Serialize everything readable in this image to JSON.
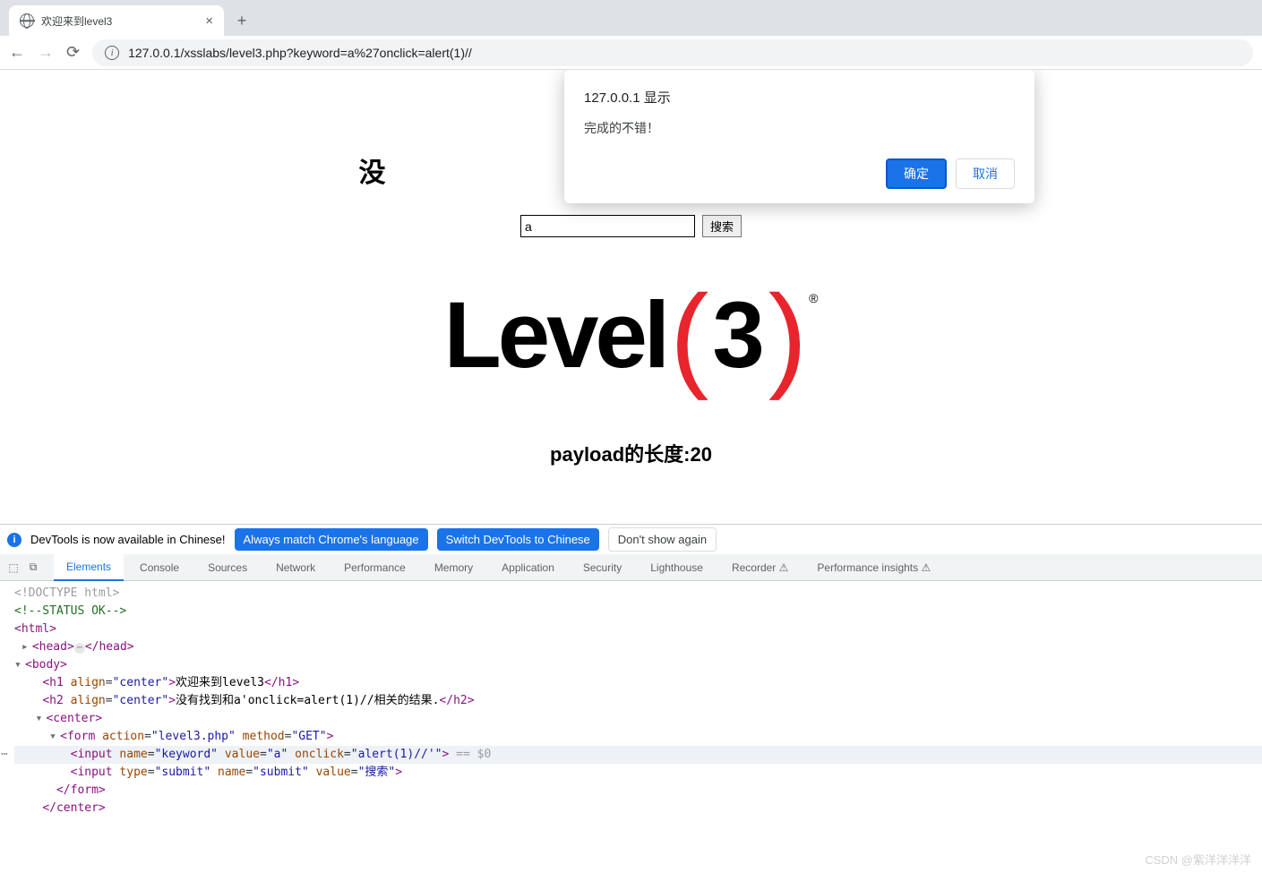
{
  "browser": {
    "tab_title": "欢迎来到level3",
    "url": "127.0.0.1/xsslabs/level3.php?keyword=a%27onclick=alert(1)//"
  },
  "dialog": {
    "title": "127.0.0.1 显示",
    "message": "完成的不错！",
    "ok": "确定",
    "cancel": "取消"
  },
  "page": {
    "heading_partial": "没",
    "heading_rest": "。",
    "input_value": "a",
    "submit_label": "搜索",
    "logo_text": "Level",
    "logo_num": "3",
    "payload_label": "payload的长度:20"
  },
  "devtools_bar": {
    "msg": "DevTools is now available in Chinese!",
    "chip1": "Always match Chrome's language",
    "chip2": "Switch DevTools to Chinese",
    "chip3": "Don't show again"
  },
  "dev_tabs": [
    "Elements",
    "Console",
    "Sources",
    "Network",
    "Performance",
    "Memory",
    "Application",
    "Security",
    "Lighthouse",
    "Recorder ⚠",
    "Performance insights ⚠"
  ],
  "dom": {
    "doctype": "<!DOCTYPE html>",
    "comment": "<!--STATUS OK-->",
    "html_open": "<html>",
    "head_open": "<head>",
    "head_close": "</head>",
    "body_open": "<body>",
    "h1_open": "<h1 ",
    "align_attr": "align",
    "align_val": "\"center\"",
    "h1_text": "欢迎来到level3",
    "h1_close": "</h1>",
    "h2_open": "<h2 ",
    "h2_text": "没有找到和a'onclick=alert(1)//相关的结果.",
    "h2_close": "</h2>",
    "center_open": "<center>",
    "form_open": "<form ",
    "action_attr": "action",
    "action_val": "\"level3.php\"",
    "method_attr": "method",
    "method_val": "\"GET\"",
    "input1": "<input ",
    "name_attr": "name",
    "name_val": "\"keyword\"",
    "value_attr": "value",
    "value_val": "\"a\"",
    "onclick_attr": "onclick",
    "onclick_val": "\"alert(1)//'\"",
    "sel_marker": " == $0",
    "input2": "<input ",
    "type_attr": "type",
    "type_val": "\"submit\"",
    "name2_val": "\"submit\"",
    "value2_val": "\"搜索\"",
    "form_close": "</form>",
    "center_close": "</center>"
  },
  "watermark": "CSDN @紫洋洋洋洋"
}
